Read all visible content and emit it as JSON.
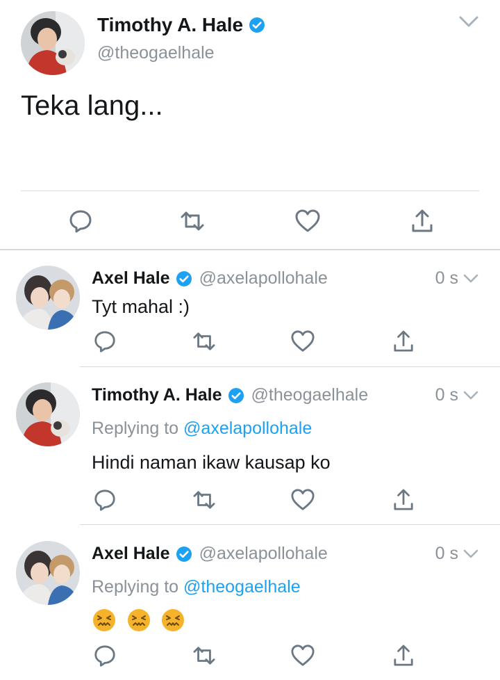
{
  "main_tweet": {
    "name": "Timothy A. Hale",
    "handle": "@theogaelhale",
    "text": "Teka lang..."
  },
  "replies": [
    {
      "name": "Axel Hale",
      "handle": "@axelapollohale",
      "time": "0 s",
      "replying_prefix": "",
      "replying_to": "",
      "text": "Tyt mahal :)"
    },
    {
      "name": "Timothy A. Hale",
      "handle": "@theogaelhale",
      "time": "0 s",
      "replying_prefix": "Replying to",
      "replying_to": "@axelapollohale",
      "text": "Hindi naman ikaw kausap ko"
    },
    {
      "name": "Axel Hale",
      "handle": "@axelapollohale",
      "time": "0 s",
      "replying_prefix": "Replying to",
      "replying_to": "@theogaelhale",
      "text": ""
    }
  ],
  "icons": {
    "reply": "reply-icon",
    "retweet": "retweet-icon",
    "like": "heart-icon",
    "share": "share-icon",
    "verified": "verified-badge-icon",
    "menu": "chevron-down-icon",
    "emoji": "confounded-face-emoji"
  },
  "colors": {
    "accent": "#1da1f2",
    "secondary_text": "#8a9199",
    "icon": "#6b7782",
    "emoji_face": "#f5b32b"
  }
}
